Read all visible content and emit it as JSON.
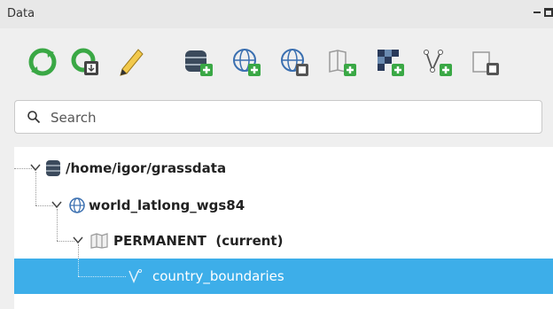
{
  "panel": {
    "title": "Data"
  },
  "toolbar": {
    "items": [
      {
        "icon": "reload-icon"
      },
      {
        "icon": "reload-current-mapset-icon"
      },
      {
        "icon": "edit-pencil-icon"
      },
      {
        "icon": "add-grassdb-icon"
      },
      {
        "icon": "add-location-icon"
      },
      {
        "icon": "import-location-icon"
      },
      {
        "icon": "add-mapset-icon"
      },
      {
        "icon": "add-raster-icon"
      },
      {
        "icon": "add-vector-icon"
      },
      {
        "icon": "import-layer-icon"
      }
    ]
  },
  "search": {
    "placeholder": "Search"
  },
  "tree": {
    "grassdb": "/home/igor/grassdata",
    "location": "world_latlong_wgs84",
    "mapset": "PERMANENT  (current)",
    "layer": "country_boundaries"
  },
  "colors": {
    "selection": "#3daee9",
    "accent_green": "#3aa845"
  }
}
